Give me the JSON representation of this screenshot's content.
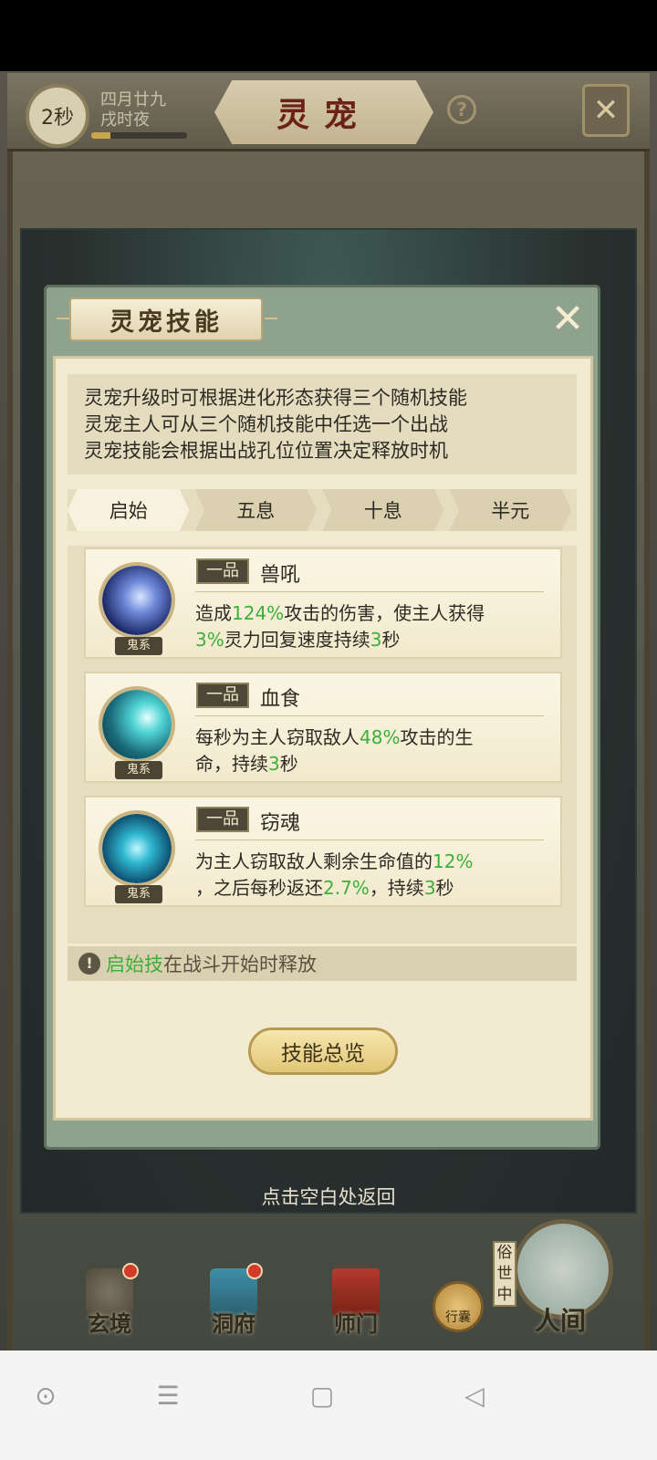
{
  "header": {
    "timer": "2秒",
    "date_line1": "四月廿九",
    "date_line2": "戌时夜",
    "time_progress": 0.2,
    "title": "灵宠"
  },
  "modal": {
    "title": "灵宠技能",
    "description": [
      "灵宠升级时可根据进化形态获得三个随机技能",
      "灵宠主人可从三个随机技能中任选一个出战",
      "灵宠技能会根据出战孔位位置决定释放时机"
    ],
    "tabs": [
      {
        "label": "启始",
        "active": true
      },
      {
        "label": "五息",
        "active": false
      },
      {
        "label": "十息",
        "active": false
      },
      {
        "label": "半元",
        "active": false
      }
    ],
    "skills": [
      {
        "grade": "一品",
        "name": "兽吼",
        "tag": "鬼系",
        "desc_line1": {
          "a": "造成",
          "b": "124%",
          "c": "攻击的伤害，使主人获得"
        },
        "desc_line2": {
          "a": "3%",
          "b": "灵力回复速度持续",
          "c": "3",
          "d": "秒"
        }
      },
      {
        "grade": "一品",
        "name": "血食",
        "tag": "鬼系",
        "desc_line1": {
          "a": "每秒为主人窃取敌人",
          "b": "48%",
          "c": "攻击的生"
        },
        "desc_line2": {
          "a": "命，持续",
          "b": "3",
          "c": "秒"
        }
      },
      {
        "grade": "一品",
        "name": "窃魂",
        "tag": "鬼系",
        "desc_line1": {
          "a": "为主人窃取敌人剩余生命值的",
          "b": "12%"
        },
        "desc_line2": {
          "a": "，之后每秒返还",
          "b": "2.7%",
          "c": "，持续",
          "d": "3",
          "e": "秒"
        }
      }
    ],
    "notice": {
      "highlight": "启始技",
      "rest": "在战斗开始时释放"
    },
    "overview_button": "技能总览"
  },
  "return_hint": "点击空白处返回",
  "bottom_nav": {
    "items": [
      "玄境",
      "洞府",
      "师门"
    ],
    "pack": "行囊",
    "secular": "俗世中",
    "world": "人间"
  },
  "colors": {
    "highlight_green": "#3fae3a",
    "title_red": "#6b2317"
  }
}
